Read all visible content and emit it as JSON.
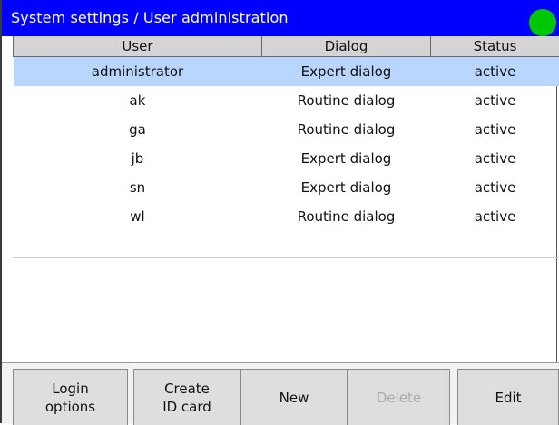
{
  "window": {
    "title": "System settings / User administration",
    "status_indicator": {
      "icon": "status-led-icon",
      "color": "#00c800"
    }
  },
  "table": {
    "columns": [
      "User",
      "Dialog",
      "Status"
    ],
    "rows": [
      {
        "user": "administrator",
        "dialog": "Expert dialog",
        "status": "active",
        "selected": true
      },
      {
        "user": "ak",
        "dialog": "Routine dialog",
        "status": "active"
      },
      {
        "user": "ga",
        "dialog": "Routine dialog",
        "status": "active"
      },
      {
        "user": "jb",
        "dialog": "Expert dialog",
        "status": "active"
      },
      {
        "user": "sn",
        "dialog": "Expert dialog",
        "status": "active"
      },
      {
        "user": "wl",
        "dialog": "Routine dialog",
        "status": "active"
      }
    ]
  },
  "buttons": {
    "login_options": "Login\noptions",
    "create_id_card": "Create\nID card",
    "new": "New",
    "delete": "Delete",
    "edit": "Edit"
  },
  "colors": {
    "titlebar": "#0000ff",
    "selection": "#b8d6ff",
    "header": "#d4d4d4"
  }
}
